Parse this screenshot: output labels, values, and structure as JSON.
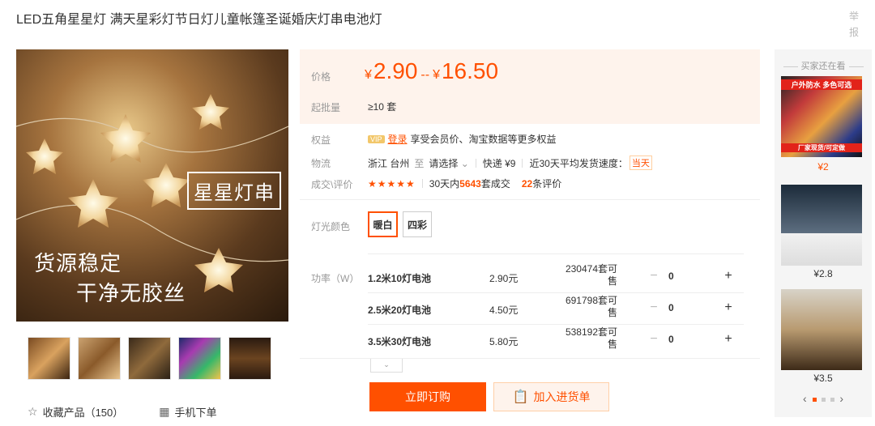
{
  "title": "LED五角星星灯 满天星彩灯节日灯儿童帐篷圣诞婚庆灯串电池灯",
  "report": "举报",
  "gallery": {
    "tag": "星星灯串",
    "slogan1": "货源稳定",
    "slogan2": "干净无胶丝",
    "thumb_count": 5
  },
  "favorite": {
    "icon": "star-outline-icon",
    "label": "收藏产品（150）"
  },
  "mobile_order": {
    "icon": "qr-code-icon",
    "label": "手机下单"
  },
  "price": {
    "label": "价格",
    "currency": "¥",
    "low": "2.90",
    "sep": "--",
    "high": "16.50"
  },
  "moq": {
    "label": "起批量",
    "value": "≥10 套"
  },
  "rights": {
    "label": "权益",
    "badge": "VIP",
    "login": "登录",
    "text": "享受会员价、淘宝数据等更多权益"
  },
  "logistics": {
    "label": "物流",
    "origin": "浙江 台州",
    "to": "至",
    "select": "请选择",
    "express": "快递 ¥9",
    "speed_label": "近30天平均发货速度：",
    "speed_value": "当天"
  },
  "deals": {
    "label": "成交\\评价",
    "stars": "★★★★★",
    "prefix": "30天内",
    "count": "5643",
    "suffix": "套成交",
    "reviews": "22",
    "reviews_suffix": "条评价"
  },
  "color": {
    "label": "灯光颜色",
    "options": [
      "暖白",
      "四彩"
    ],
    "selected": "暖白"
  },
  "power": {
    "label": "功率（W）"
  },
  "skus": [
    {
      "name": "1.2米10灯电池",
      "price": "2.90元",
      "stock": "230474套可售",
      "qty": "0"
    },
    {
      "name": "2.5米20灯电池",
      "price": "4.50元",
      "stock": "691798套可售",
      "qty": "0"
    },
    {
      "name": "3.5米30灯电池",
      "price": "5.80元",
      "stock": "538192套可售",
      "qty": "0"
    }
  ],
  "stepper": {
    "minus": "−",
    "plus": "+"
  },
  "buttons": {
    "order": "立即订购",
    "cart": "加入进货单"
  },
  "rail": {
    "title": "买家还在看",
    "items": [
      {
        "price": "¥2",
        "band_top": "户外防水 多色可选",
        "band_bottom": "厂家现货/可定做"
      },
      {
        "price": "¥2.8"
      },
      {
        "price": "¥3.5"
      }
    ],
    "prev": "‹",
    "next": "›"
  },
  "colors": {
    "accent": "#ff5000",
    "price_bg": "#fef3ec"
  }
}
